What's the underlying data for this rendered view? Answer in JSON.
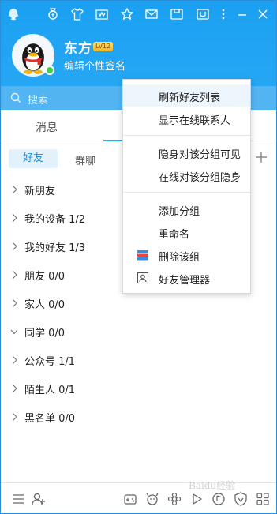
{
  "header": {
    "nickname": "东方",
    "level": "LV12",
    "signature": "编辑个性签名"
  },
  "search": {
    "placeholder": "搜索"
  },
  "tabs": {
    "messages": "消息"
  },
  "subtabs": {
    "friends": "好友",
    "groups": "群聊"
  },
  "groups": [
    {
      "label": "新朋友",
      "expanded": false
    },
    {
      "label": "我的设备 1/2",
      "expanded": false
    },
    {
      "label": "我的好友 1/3",
      "expanded": false
    },
    {
      "label": "朋友 0/0",
      "expanded": false
    },
    {
      "label": "家人 0/0",
      "expanded": false
    },
    {
      "label": "同学 0/0",
      "expanded": true
    },
    {
      "label": "公众号 1/1",
      "expanded": false
    },
    {
      "label": "陌生人 0/1",
      "expanded": false
    },
    {
      "label": "黑名单 0/0",
      "expanded": false
    }
  ],
  "context_menu": {
    "items": [
      {
        "label": "刷新好友列表",
        "icon": null
      },
      {
        "label": "显示在线联系人",
        "icon": null
      },
      {
        "label": "隐身对该分组可见",
        "icon": null
      },
      {
        "label": "在线对该分组隐身",
        "icon": null
      },
      {
        "label": "添加分组",
        "icon": null
      },
      {
        "label": "重命名",
        "icon": null
      },
      {
        "label": "删除该组",
        "icon": "delete-group-icon"
      },
      {
        "label": "好友管理器",
        "icon": "friend-manager-icon"
      }
    ]
  },
  "colors": {
    "header": "#1ba0f2",
    "search": "#53b4f2",
    "accent": "#12b7f5",
    "online": "#3fcf4e"
  },
  "watermark": "Baidu经验"
}
